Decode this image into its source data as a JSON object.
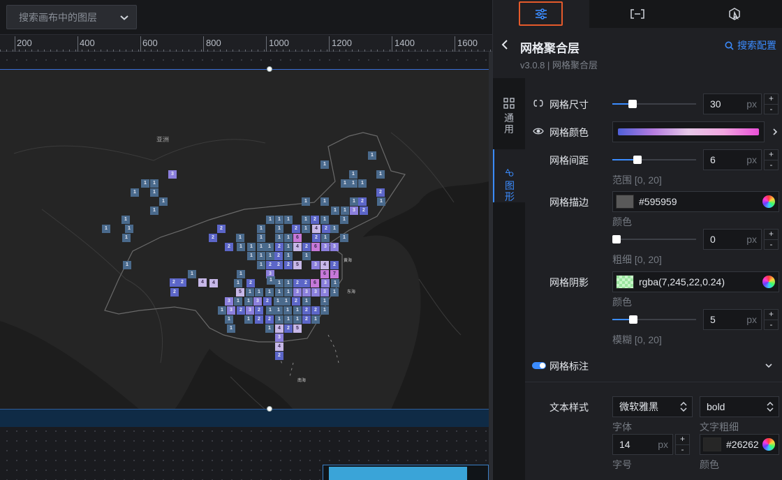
{
  "canvas": {
    "layer_search_placeholder": "搜索画布中的图层",
    "ruler_labels": [
      "200",
      "400",
      "600",
      "800",
      "1000",
      "1200",
      "1400",
      "1600"
    ],
    "map_labels": {
      "asia": "亚洲",
      "japan_sea": "黄海",
      "east_sea": "东海",
      "south_sea": "南海"
    }
  },
  "grid_cells": [
    [
      "1",
      0,
      0
    ],
    [
      "1",
      0,
      0
    ],
    [
      "1",
      0,
      0
    ],
    [
      "1",
      0,
      0
    ],
    [
      "3",
      2,
      1
    ],
    [
      "1",
      0,
      0
    ],
    [
      "1",
      0,
      0
    ],
    [
      "1",
      0,
      0
    ],
    [
      "1",
      0,
      0
    ],
    [
      "1",
      0,
      0
    ],
    [
      "1",
      0,
      0
    ],
    [
      "1",
      0,
      0
    ],
    [
      "2",
      1,
      0
    ],
    [
      "1",
      0,
      0
    ],
    [
      "2",
      1,
      0
    ],
    [
      "1",
      0,
      0
    ],
    [
      "1",
      0,
      0
    ],
    [
      "1",
      0,
      0
    ],
    [
      "1",
      0,
      0
    ],
    [
      "1",
      0,
      0
    ],
    [
      "1",
      0,
      0
    ],
    [
      "1",
      0,
      0
    ],
    [
      "3",
      2,
      1
    ],
    [
      "2",
      1,
      0
    ],
    [
      "1",
      0,
      0
    ],
    [
      "1",
      0,
      0
    ],
    [
      "1",
      0,
      0
    ],
    [
      "1",
      0,
      0
    ],
    [
      "1",
      0,
      0
    ],
    [
      "2",
      1,
      0
    ],
    [
      "1",
      0,
      0
    ],
    [
      "1",
      0,
      0
    ],
    [
      "1",
      0,
      0
    ],
    [
      "1",
      0,
      0
    ],
    [
      "2",
      1,
      0
    ],
    [
      "1",
      0,
      0
    ],
    [
      "1",
      0,
      0
    ],
    [
      "2",
      1,
      0
    ],
    [
      "1",
      0,
      0
    ],
    [
      "4",
      3,
      1
    ],
    [
      "2",
      1,
      0
    ],
    [
      "1",
      0,
      0
    ],
    [
      "1",
      0,
      0
    ],
    [
      "2",
      1,
      0
    ],
    [
      "1",
      0,
      0
    ],
    [
      "1",
      0,
      0
    ],
    [
      "1",
      0,
      0
    ],
    [
      "1",
      0,
      0
    ],
    [
      "6",
      4,
      1
    ],
    [
      "2",
      1,
      0
    ],
    [
      "1",
      0,
      0
    ],
    [
      "1",
      0,
      0
    ],
    [
      "2",
      1,
      0
    ],
    [
      "1",
      0,
      0
    ],
    [
      "1",
      0,
      0
    ],
    [
      "1",
      0,
      0
    ],
    [
      "1",
      0,
      0
    ],
    [
      "2",
      1,
      0
    ],
    [
      "1",
      0,
      0
    ],
    [
      "4",
      3,
      1
    ],
    [
      "2",
      1,
      0
    ],
    [
      "6",
      4,
      1
    ],
    [
      "3",
      2,
      1
    ],
    [
      "3",
      2,
      1
    ],
    [
      "1",
      0,
      0
    ],
    [
      "1",
      0,
      0
    ],
    [
      "1",
      0,
      0
    ],
    [
      "2",
      1,
      0
    ],
    [
      "1",
      0,
      0
    ],
    [
      "1",
      0,
      0
    ],
    [
      "5",
      3,
      1
    ],
    [
      "3",
      2,
      1
    ],
    [
      "4",
      3,
      1
    ],
    [
      "2",
      1,
      0
    ],
    [
      "1",
      0,
      0
    ],
    [
      "2",
      1,
      0
    ],
    [
      "2",
      1,
      0
    ],
    [
      "2",
      1,
      0
    ],
    [
      "2",
      1,
      0
    ],
    [
      "3",
      2,
      1
    ],
    [
      "7",
      4,
      1
    ],
    [
      "6",
      4,
      1
    ],
    [
      "1",
      0,
      0
    ],
    [
      "1",
      0,
      0
    ],
    [
      "1",
      0,
      0
    ],
    [
      "1",
      0,
      0
    ],
    [
      "2",
      1,
      0
    ],
    [
      "4",
      3,
      1
    ],
    [
      "4",
      3,
      1
    ],
    [
      "1",
      0,
      0
    ],
    [
      "2",
      1,
      0
    ],
    [
      "1",
      0,
      0
    ],
    [
      "1",
      0,
      0
    ],
    [
      "2",
      1,
      0
    ],
    [
      "2",
      1,
      0
    ],
    [
      "6",
      4,
      1
    ],
    [
      "3",
      2,
      1
    ],
    [
      "1",
      0,
      0
    ],
    [
      "5",
      3,
      1
    ],
    [
      "1",
      0,
      0
    ],
    [
      "1",
      0,
      0
    ],
    [
      "1",
      0,
      0
    ],
    [
      "1",
      0,
      0
    ],
    [
      "1",
      0,
      0
    ],
    [
      "3",
      2,
      1
    ],
    [
      "3",
      2,
      1
    ],
    [
      "3",
      2,
      1
    ],
    [
      "3",
      2,
      1
    ],
    [
      "1",
      0,
      0
    ],
    [
      "2",
      1,
      0
    ],
    [
      "3",
      2,
      1
    ],
    [
      "1",
      0,
      0
    ],
    [
      "1",
      0,
      0
    ],
    [
      "3",
      2,
      1
    ],
    [
      "2",
      1,
      0
    ],
    [
      "1",
      0,
      0
    ],
    [
      "1",
      0,
      0
    ],
    [
      "2",
      1,
      0
    ],
    [
      "1",
      0,
      0
    ],
    [
      "1",
      0,
      0
    ],
    [
      "1",
      0,
      0
    ],
    [
      "3",
      2,
      1
    ],
    [
      "2",
      1,
      0
    ],
    [
      "3",
      2,
      1
    ],
    [
      "2",
      1,
      0
    ],
    [
      "1",
      0,
      0
    ],
    [
      "1",
      0,
      0
    ],
    [
      "1",
      0,
      0
    ],
    [
      "1",
      0,
      0
    ],
    [
      "2",
      1,
      0
    ],
    [
      "2",
      1,
      0
    ],
    [
      "1",
      0,
      0
    ],
    [
      "1",
      0,
      0
    ],
    [
      "1",
      0,
      0
    ],
    [
      "2",
      1,
      0
    ],
    [
      "2",
      1,
      0
    ],
    [
      "1",
      0,
      0
    ],
    [
      "1",
      0,
      0
    ],
    [
      "1",
      0,
      0
    ],
    [
      "2",
      1,
      0
    ],
    [
      "1",
      0,
      0
    ],
    [
      "1",
      0,
      0
    ],
    [
      "1",
      0,
      0
    ],
    [
      "4",
      3,
      1
    ],
    [
      "2",
      1,
      0
    ],
    [
      "5",
      3,
      1
    ],
    [
      "3",
      2,
      1
    ],
    [
      "4",
      3,
      1
    ],
    [
      "2",
      1,
      0
    ],
    [
      "1",
      0,
      0
    ],
    [
      "1",
      0,
      0
    ],
    [
      "2",
      1,
      0
    ],
    [
      "2",
      1,
      0
    ],
    [
      "2",
      1,
      0
    ],
    [
      "6",
      4,
      1
    ],
    [
      "2",
      1,
      0
    ],
    [
      "2",
      1,
      0
    ],
    [
      "2",
      1,
      0
    ]
  ],
  "panel": {
    "tabs": [
      "config",
      "data",
      "interaction"
    ],
    "title": "网格聚合层",
    "version": "v3.0.8 | 网格聚合层",
    "search_config": "搜索配置",
    "side_tabs": [
      {
        "label": "通用"
      },
      {
        "label": "图形"
      }
    ],
    "grid_size": {
      "label": "网格尺寸",
      "value": "30",
      "unit": "px",
      "fill": 0.24
    },
    "grid_color": {
      "label": "网格颜色"
    },
    "grid_gap": {
      "label": "网格间距",
      "value": "6",
      "unit": "px",
      "range": "范围 [0, 20]",
      "fill": 0.3
    },
    "grid_stroke": {
      "label": "网格描边",
      "color": "#595959",
      "color_hint": "颜色",
      "width_value": "0",
      "unit": "px",
      "width_hint": "粗细 [0, 20]",
      "fill": 0.0
    },
    "grid_shadow": {
      "label": "网格阴影",
      "color": "rgba(7,245,22,0.24)",
      "color_hint": "颜色",
      "blur_value": "5",
      "unit": "px",
      "blur_hint": "模糊 [0, 20]",
      "fill": 0.25
    },
    "grid_label": {
      "label": "网格标注"
    },
    "text_style": {
      "label": "文本样式",
      "font": "微软雅黑",
      "font_hint": "字体",
      "weight": "bold",
      "weight_hint": "文字粗细",
      "size": "14",
      "unit": "px",
      "size_hint": "字号",
      "color": "#26262",
      "color_hint": "颜色"
    }
  },
  "colors": {
    "accent": "#3b8cff",
    "tab_highlight": "#e55a2b",
    "stroke_swatch": "#595959",
    "text_swatch": "#262626"
  }
}
